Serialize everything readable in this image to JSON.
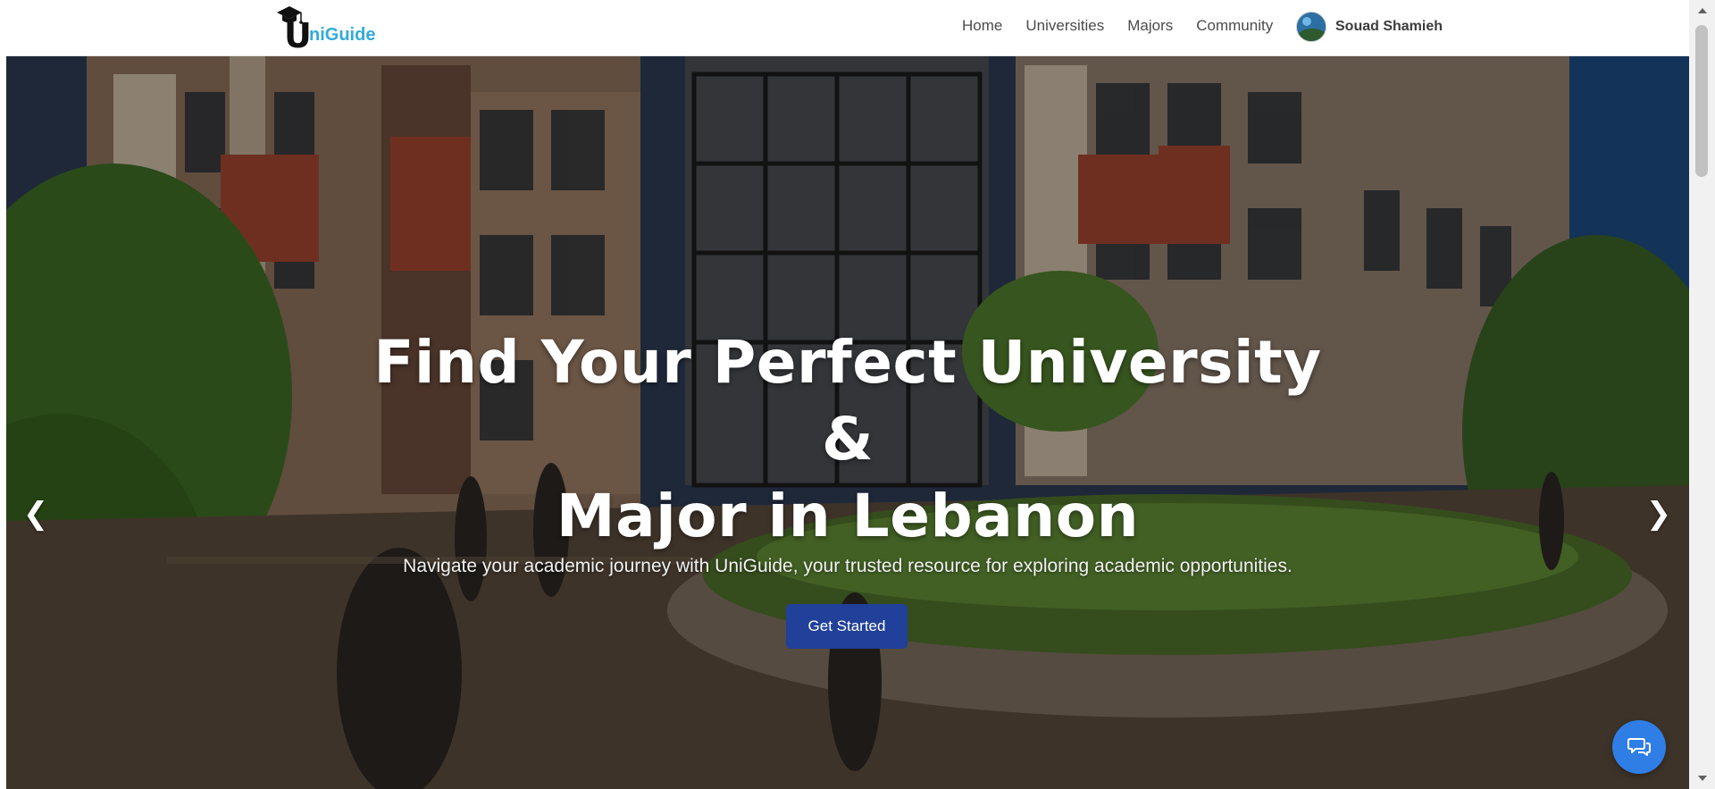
{
  "brand": {
    "logo_initial": "U",
    "logo_rest": "niGuide",
    "logo_color": "#33aadd"
  },
  "nav": {
    "items": [
      {
        "label": "Home"
      },
      {
        "label": "Universities"
      },
      {
        "label": "Majors"
      },
      {
        "label": "Community"
      }
    ],
    "profile_name": "Souad Shamieh"
  },
  "hero": {
    "title_line1": "Find Your Perfect University &",
    "title_line2": "Major in Lebanon",
    "subtitle": "Navigate your academic journey with UniGuide, your trusted resource for exploring academic opportunities.",
    "cta_label": "Get Started",
    "prev_arrow": "❮",
    "next_arrow": "❯",
    "cta_color": "#21409a"
  },
  "chat": {
    "icon": "chat-bubbles-icon",
    "color": "#2f7ee6"
  },
  "icons": {
    "logo": "graduation-cap-icon",
    "avatar": "earth-avatar-icon"
  }
}
